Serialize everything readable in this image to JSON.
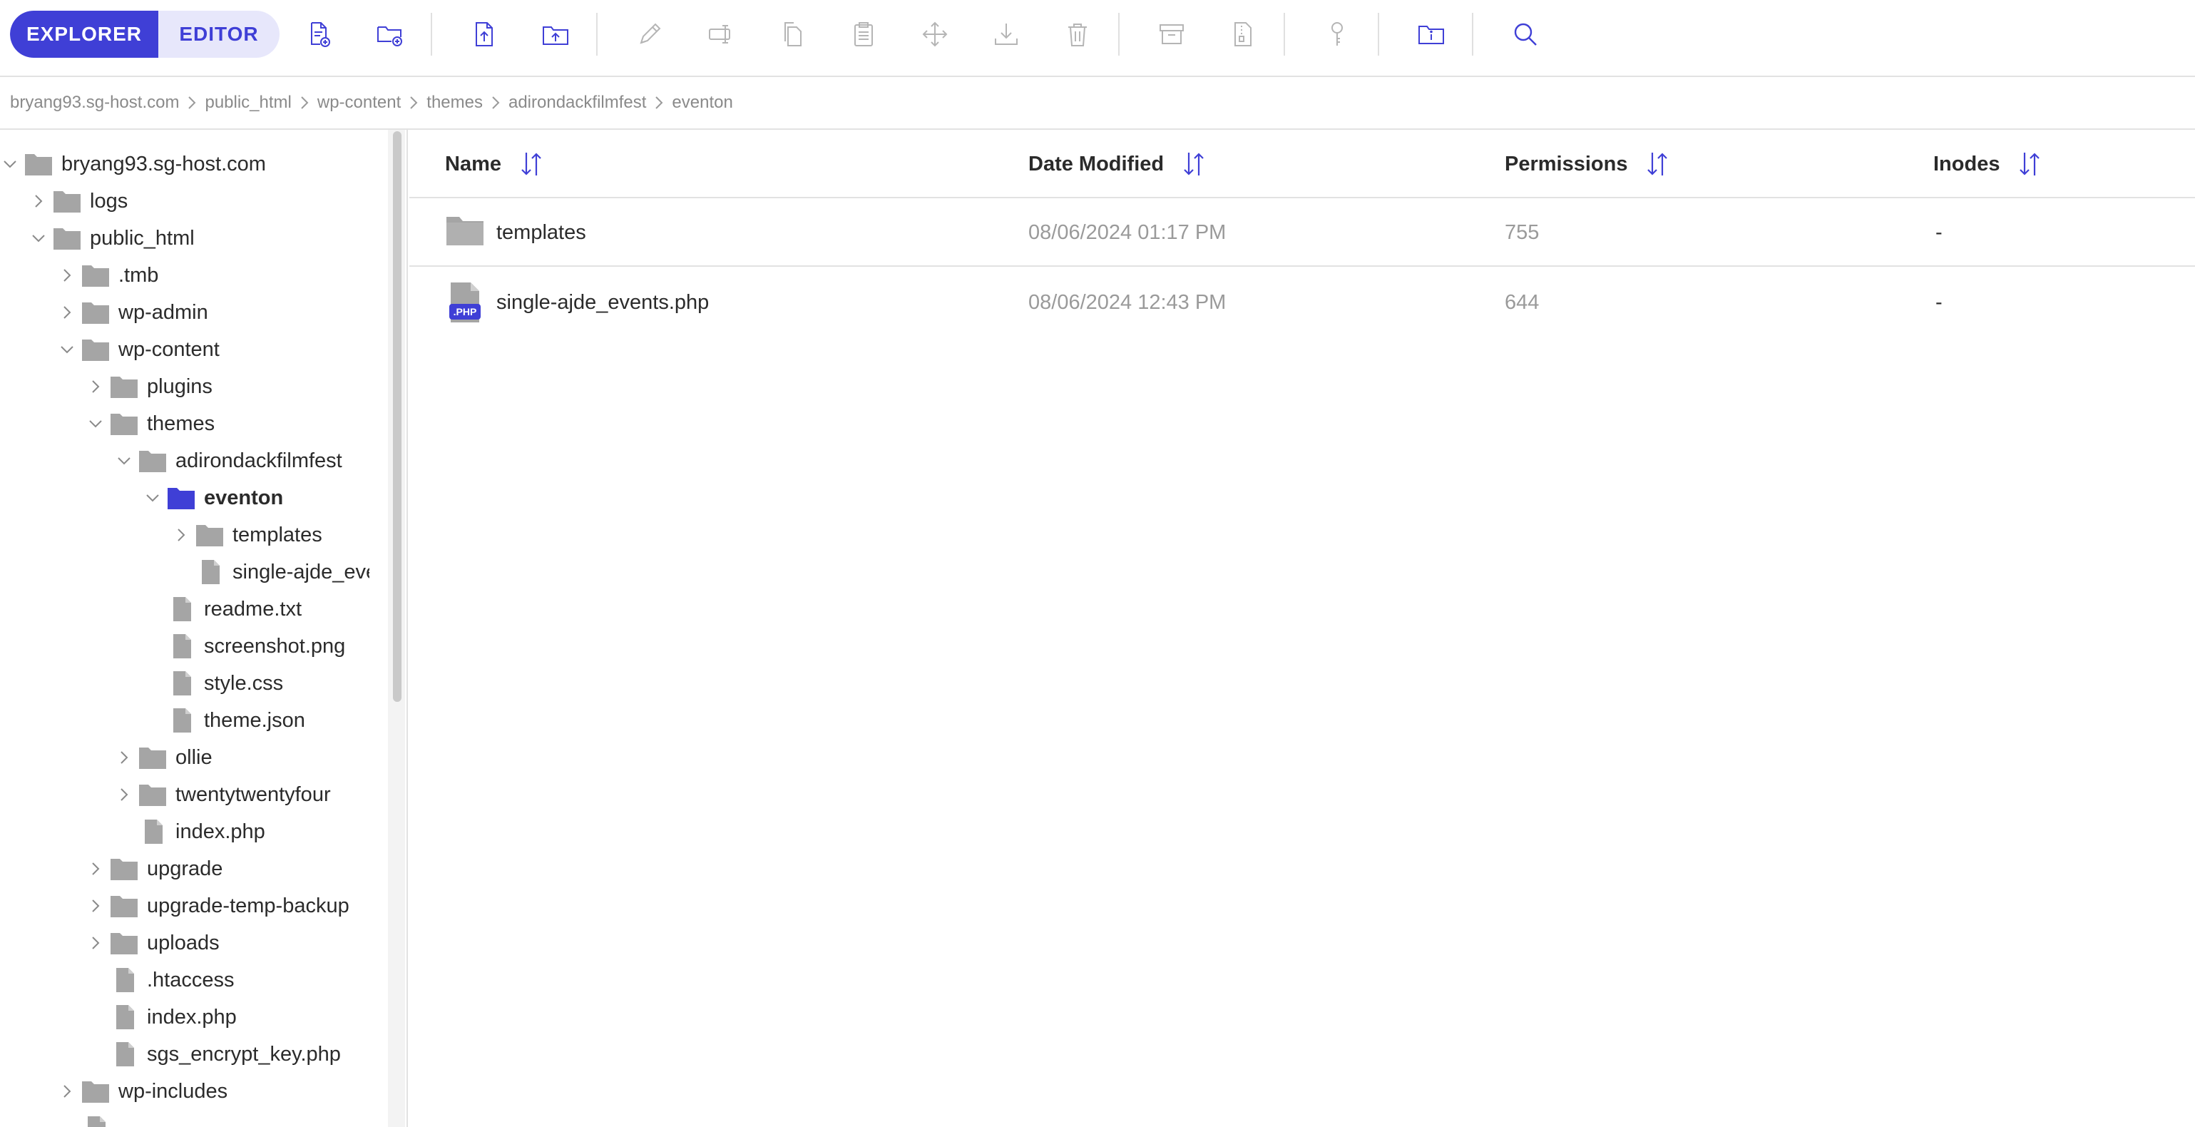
{
  "toolbar": {
    "explorer_label": "EXPLORER",
    "editor_label": "EDITOR",
    "accent": "#3f3fd6",
    "icons": [
      "new-file-icon",
      "new-folder-icon",
      "upload-file-icon",
      "upload-folder-icon",
      "rename-icon",
      "rename-field-icon",
      "copy-icon",
      "paste-icon",
      "move-icon",
      "download-icon",
      "delete-icon",
      "archive-icon",
      "extract-icon",
      "permissions-icon",
      "folder-info-icon",
      "search-icon"
    ]
  },
  "breadcrumb": [
    "bryang93.sg-host.com",
    "public_html",
    "wp-content",
    "themes",
    "adirondackfilmfest",
    "eventon"
  ],
  "tree": [
    {
      "label": "bryang93.sg-host.com",
      "type": "folder",
      "expanded": true
    },
    {
      "label": "logs",
      "type": "folder",
      "expanded": false
    },
    {
      "label": "public_html",
      "type": "folder",
      "expanded": true
    },
    {
      "label": ".tmb",
      "type": "folder",
      "expanded": false
    },
    {
      "label": "wp-admin",
      "type": "folder",
      "expanded": false
    },
    {
      "label": "wp-content",
      "type": "folder",
      "expanded": true
    },
    {
      "label": "plugins",
      "type": "folder",
      "expanded": false
    },
    {
      "label": "themes",
      "type": "folder",
      "expanded": true
    },
    {
      "label": "adirondackfilmfest",
      "type": "folder",
      "expanded": true
    },
    {
      "label": "eventon",
      "type": "folder",
      "expanded": true,
      "selected": true
    },
    {
      "label": "templates",
      "type": "folder",
      "expanded": false
    },
    {
      "label": "single-ajde_events.php",
      "type": "file"
    },
    {
      "label": "readme.txt",
      "type": "file"
    },
    {
      "label": "screenshot.png",
      "type": "file"
    },
    {
      "label": "style.css",
      "type": "file"
    },
    {
      "label": "theme.json",
      "type": "file"
    },
    {
      "label": "ollie",
      "type": "folder",
      "expanded": false
    },
    {
      "label": "twentytwentyfour",
      "type": "folder",
      "expanded": false
    },
    {
      "label": "index.php",
      "type": "file"
    },
    {
      "label": "upgrade",
      "type": "folder",
      "expanded": false
    },
    {
      "label": "upgrade-temp-backup",
      "type": "folder",
      "expanded": false
    },
    {
      "label": "uploads",
      "type": "folder",
      "expanded": false
    },
    {
      "label": ".htaccess",
      "type": "file"
    },
    {
      "label": "index.php",
      "type": "file"
    },
    {
      "label": "sgs_encrypt_key.php",
      "type": "file"
    },
    {
      "label": "wp-includes",
      "type": "folder",
      "expanded": false
    },
    {
      "label": "",
      "type": "file"
    }
  ],
  "table": {
    "headers": {
      "name": "Name",
      "date": "Date Modified",
      "permissions": "Permissions",
      "inodes": "Inodes"
    },
    "rows": [
      {
        "name": "templates",
        "type": "folder",
        "date": "08/06/2024 01:17 PM",
        "permissions": "755",
        "inodes": "-"
      },
      {
        "name": "single-ajde_events.php",
        "type": "php",
        "date": "08/06/2024 12:43 PM",
        "permissions": "644",
        "inodes": "-"
      }
    ],
    "php_badge": ".PHP"
  },
  "colors": {
    "folder_gray": "#a5a5a5",
    "folder_selected": "#3f3fd6",
    "php_badge": "#3f3fd6"
  }
}
